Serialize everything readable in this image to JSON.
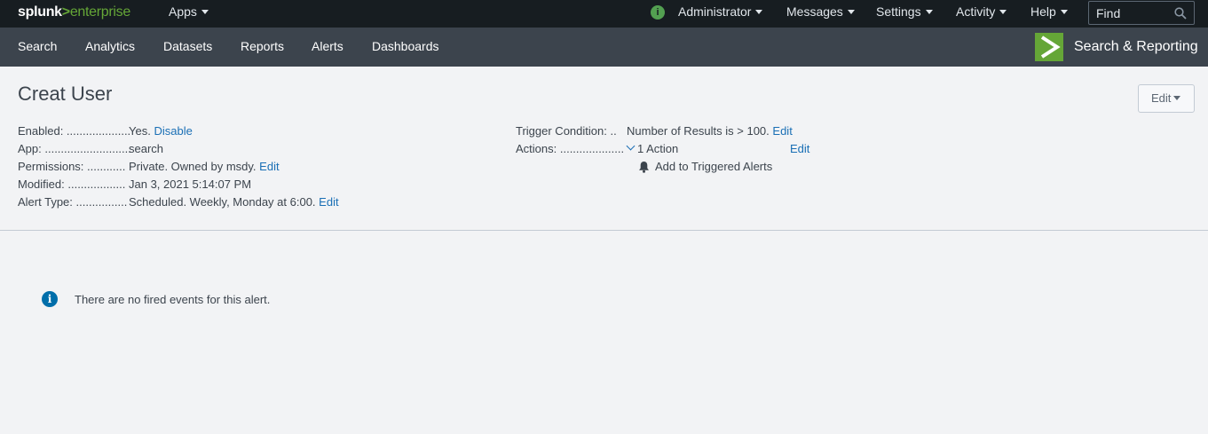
{
  "topbar": {
    "logo_splunk": "splunk",
    "logo_gt": ">",
    "logo_enterprise": "enterprise",
    "apps_label": "Apps",
    "status_icon": "i",
    "user_label": "Administrator",
    "messages_label": "Messages",
    "settings_label": "Settings",
    "activity_label": "Activity",
    "help_label": "Help",
    "find_placeholder": "Find",
    "icons": {
      "status": "info-circle-icon",
      "search": "search-icon"
    }
  },
  "appbar": {
    "nav": [
      "Search",
      "Analytics",
      "Datasets",
      "Reports",
      "Alerts",
      "Dashboards"
    ],
    "app_title": "Search & Reporting",
    "app_logo_color": "#65a637"
  },
  "alert": {
    "title": "Creat User",
    "edit_label": "Edit",
    "left_fields": [
      {
        "label": "Enabled: ....................",
        "value": "Yes.",
        "link": "Disable"
      },
      {
        "label": "App: ...........................",
        "value": "search",
        "link": ""
      },
      {
        "label": "Permissions: ............",
        "value": "Private. Owned by msdy.",
        "link": "Edit"
      },
      {
        "label": "Modified: ..................",
        "value": "Jan 3, 2021 5:14:07 PM",
        "link": ""
      },
      {
        "label": "Alert Type: ................",
        "value": "Scheduled. Weekly, Monday at 6:00.",
        "link": "Edit"
      }
    ],
    "trigger_label": "Trigger Condition: ..",
    "trigger_value": "Number of Results is > 100.",
    "trigger_link": "Edit",
    "actions_label": "Actions: ....................",
    "actions_value": "1 Action",
    "actions_link": "Edit",
    "action_item": "Add to Triggered Alerts"
  },
  "events": {
    "info_icon": "i",
    "message": "There are no fired events for this alert."
  },
  "colors": {
    "topbar_bg": "#171d21",
    "appbar_bg": "#3c444d",
    "accent_green": "#65a637",
    "link_blue": "#1a6fb5",
    "info_blue": "#006eaa"
  }
}
